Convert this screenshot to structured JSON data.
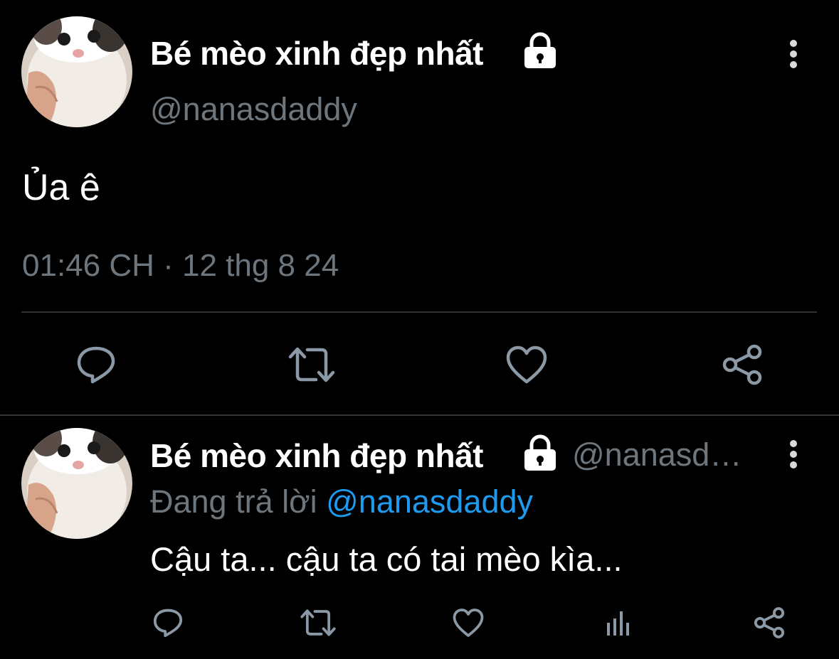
{
  "colors": {
    "background": "#000000",
    "text_primary": "#ffffff",
    "text_secondary": "#6e767d",
    "divider": "#2f3336",
    "mention": "#1d9bf0"
  },
  "main_tweet": {
    "display_name": "Bé mèo xinh đẹp nhất",
    "handle": "@nanasdaddy",
    "protected_icon": "lock-icon",
    "text": "Ủa ê",
    "timestamp": "01:46 CH · 12 thg 8 24",
    "actions": [
      "reply-icon",
      "retweet-icon",
      "like-icon",
      "share-icon"
    ]
  },
  "reply_tweet": {
    "display_name": "Bé mèo xinh đẹp nhất",
    "handle": "@nanasd…",
    "replying_prefix": "Đang trả lời ",
    "replying_to": "@nanasdaddy",
    "text": "Cậu ta... cậu ta có tai mèo kìa...",
    "actions": [
      "reply-icon",
      "retweet-icon",
      "like-icon",
      "analytics-icon",
      "share-icon"
    ]
  }
}
